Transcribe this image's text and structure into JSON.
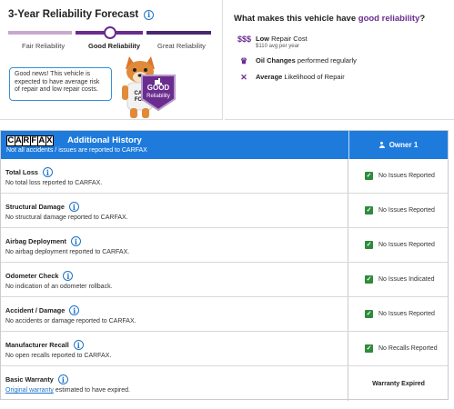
{
  "forecast": {
    "title": "3-Year Reliability Forecast",
    "scale_labels": [
      "Fair Reliability",
      "Good Reliability",
      "Great Reliability"
    ],
    "selected_index": 1,
    "bubble_text": "Good news! This vehicle is expected to have average risk of repair and low repair costs.",
    "badge": {
      "line1": "GOOD",
      "line2": "Reliability"
    },
    "fox_shirt_text": "CAR FOX"
  },
  "why": {
    "title_prefix": "What makes this vehicle have ",
    "title_highlight": "good reliability",
    "title_suffix": "?",
    "items": [
      {
        "icon": "dollar-signs-icon",
        "glyph": "$$$",
        "bold": "Low",
        "rest": " Repair Cost",
        "sub": "$110 avg per year"
      },
      {
        "icon": "oil-can-icon",
        "glyph": "♛",
        "bold": "Oil Changes",
        "rest": " performed regularly",
        "sub": ""
      },
      {
        "icon": "tools-icon",
        "glyph": "✕",
        "bold": "Average",
        "rest": " Likelihood of Repair",
        "sub": ""
      }
    ]
  },
  "history": {
    "logo_letters": [
      "C",
      "A",
      "R",
      "F",
      "A",
      "X"
    ],
    "title": "Additional History",
    "subtitle": "Not all accidents / issues are reported to CARFAX",
    "owner_label": "Owner 1",
    "rows": [
      {
        "name": "Total Loss",
        "desc": "No total loss reported to CARFAX.",
        "status": "No Issues Reported",
        "checked": true
      },
      {
        "name": "Structural Damage",
        "desc": "No structural damage reported to CARFAX.",
        "status": "No Issues Reported",
        "checked": true
      },
      {
        "name": "Airbag Deployment",
        "desc": "No airbag deployment reported to CARFAX.",
        "status": "No Issues Reported",
        "checked": true
      },
      {
        "name": "Odometer Check",
        "desc": "No indication of an odometer rollback.",
        "status": "No Issues Indicated",
        "checked": true
      },
      {
        "name": "Accident / Damage",
        "desc": "No accidents or damage reported to CARFAX.",
        "status": "No Issues Reported",
        "checked": true
      },
      {
        "name": "Manufacturer Recall",
        "desc": "No open recalls reported to CARFAX.",
        "status": "No Recalls Reported",
        "checked": true
      },
      {
        "name": "Basic Warranty",
        "desc_link": "Original warranty",
        "desc": " estimated to have expired.",
        "status": "Warranty Expired",
        "checked": false
      }
    ]
  },
  "colors": {
    "accent_purple": "#6a2c8e",
    "header_blue": "#1e7bdc",
    "check_green": "#2e8b3c",
    "link_blue": "#1e73c8"
  }
}
